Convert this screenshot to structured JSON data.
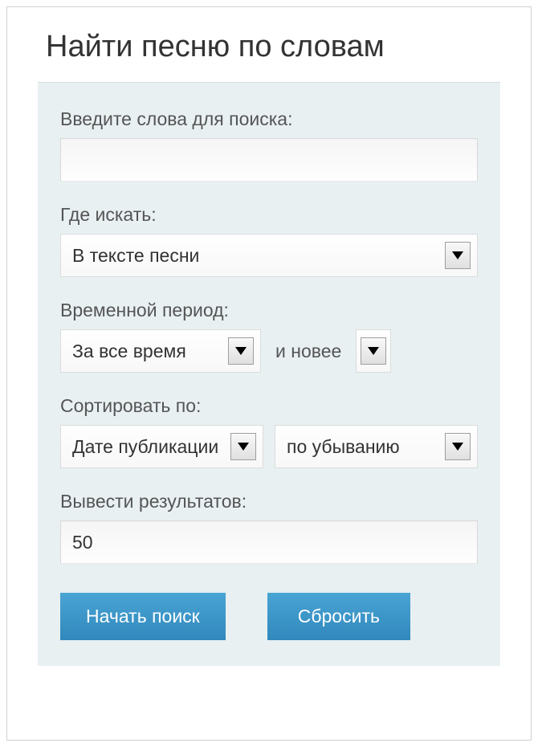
{
  "title": "Найти песню по словам",
  "form": {
    "search_words": {
      "label": "Введите слова для поиска:",
      "value": ""
    },
    "search_in": {
      "label": "Где искать:",
      "selected": "В тексте песни"
    },
    "period": {
      "label": "Временной период:",
      "selected": "За все время",
      "suffix": "и новее"
    },
    "sort": {
      "label": "Сортировать по:",
      "field": "Дате публикации",
      "direction": "по убыванию"
    },
    "results": {
      "label": "Вывести результатов:",
      "value": "50"
    },
    "buttons": {
      "submit": "Начать поиск",
      "reset": "Сбросить"
    }
  }
}
